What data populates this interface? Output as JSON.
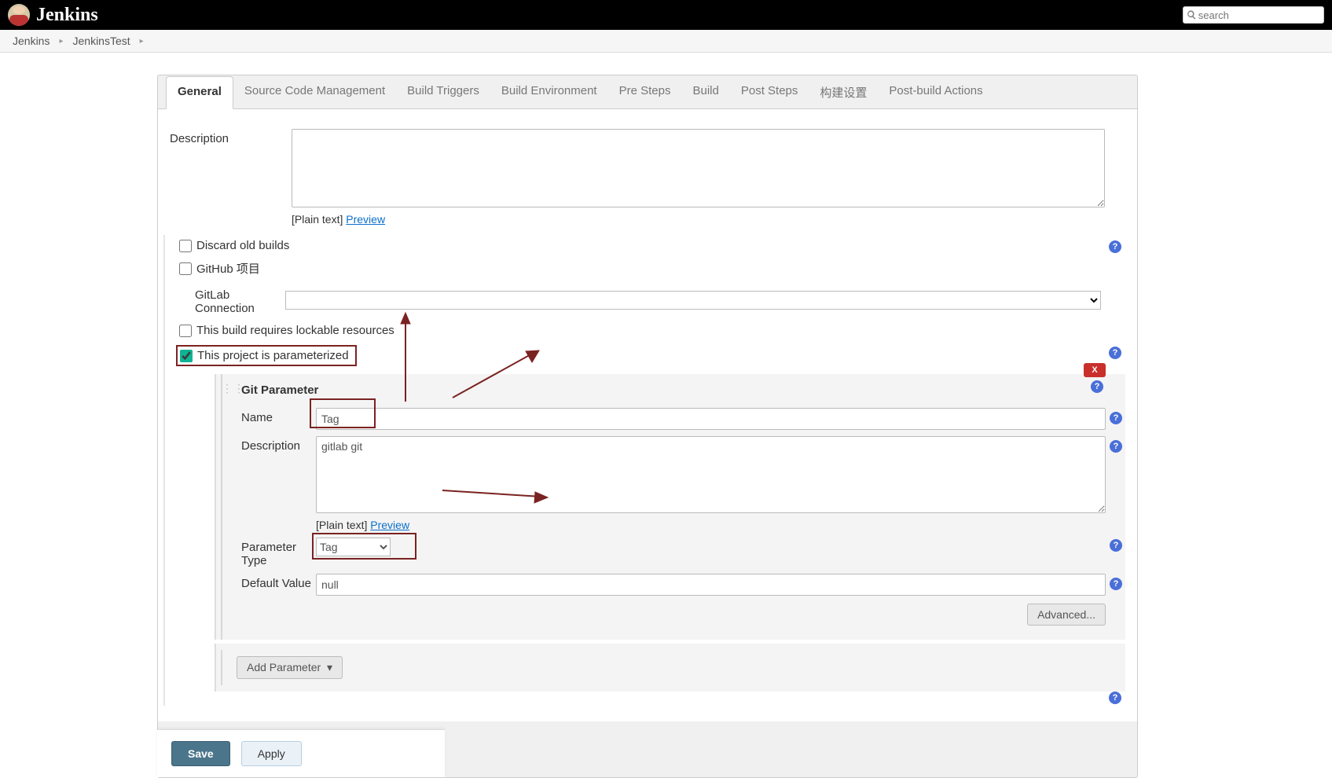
{
  "header": {
    "product": "Jenkins",
    "search_placeholder": "search"
  },
  "breadcrumb": {
    "root": "Jenkins",
    "project": "JenkinsTest"
  },
  "tabs": [
    {
      "label": "General",
      "active": true
    },
    {
      "label": "Source Code Management",
      "active": false
    },
    {
      "label": "Build Triggers",
      "active": false
    },
    {
      "label": "Build Environment",
      "active": false
    },
    {
      "label": "Pre Steps",
      "active": false
    },
    {
      "label": "Build",
      "active": false
    },
    {
      "label": "Post Steps",
      "active": false
    },
    {
      "label": "构建设置",
      "active": false
    },
    {
      "label": "Post-build Actions",
      "active": false
    }
  ],
  "labels": {
    "description": "Description",
    "plain_text": "[Plain text]",
    "preview": "Preview",
    "discard": "Discard old builds",
    "github_project": "GitHub 项目",
    "gitlab_connection": "GitLab Connection",
    "lockable": "This build requires lockable resources",
    "parameterized": "This project is parameterized"
  },
  "param": {
    "title": "Git Parameter",
    "name_label": "Name",
    "name_value": "Tag",
    "desc_label": "Description",
    "desc_value": "gitlab git",
    "type_label": "Parameter Type",
    "type_value": "Tag",
    "default_label": "Default Value",
    "default_value": "null",
    "advanced_label": "Advanced...",
    "add_param_label": "Add Parameter",
    "delete_label": "X"
  },
  "buttons": {
    "save": "Save",
    "apply": "Apply"
  }
}
